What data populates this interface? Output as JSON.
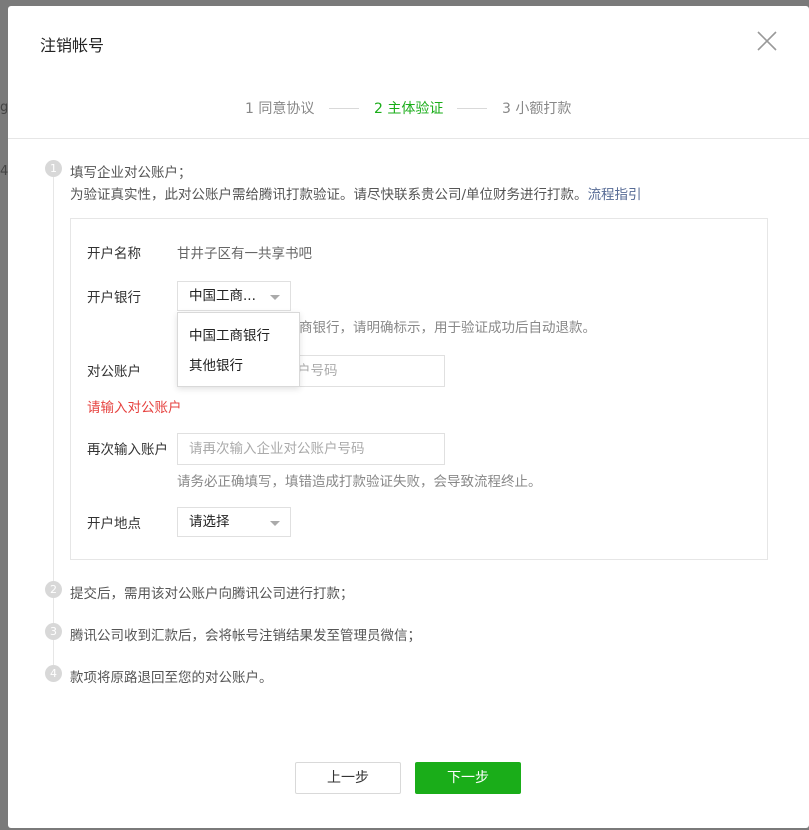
{
  "background_hints": [
    "g",
    "4"
  ],
  "dialog": {
    "title": "注销帐号",
    "close_icon": "close-icon"
  },
  "steps": [
    {
      "label": "1 同意协议",
      "active": false
    },
    {
      "label": "2 主体验证",
      "active": true
    },
    {
      "label": "3 小额打款",
      "active": false
    }
  ],
  "sections": [
    {
      "number": "1",
      "line1": "填写企业对公账户；",
      "line2": "为验证真实性，此对公账户需给腾讯打款验证。请尽快联系贵公司/单位财务进行打款。",
      "link": "流程指引"
    },
    {
      "number": "2",
      "text": "提交后，需用该对公账户向腾讯公司进行打款；"
    },
    {
      "number": "3",
      "text": "腾讯公司收到汇款后，会将帐号注销结果发至管理员微信；"
    },
    {
      "number": "4",
      "text": "款项将原路退回至您的对公账户。"
    }
  ],
  "form": {
    "account_name_label": "开户名称",
    "account_name_value": "甘井子区有一共享书吧",
    "bank_label": "开户银行",
    "bank_selected": "中国工商...",
    "bank_hint": "商银行，请明确标示，用于验证成功后自动退款。",
    "bank_options": [
      "中国工商银行",
      "其他银行"
    ],
    "account_label": "对公账户",
    "account_placeholder": "请输入企业对公账户号码",
    "account_error": "请输入对公账户",
    "reenter_label": "再次输入账户",
    "reenter_placeholder": "请再次输入企业对公账户号码",
    "reenter_hint": "请务必正确填写，填错造成打款验证失败，会导致流程终止。",
    "location_label": "开户地点",
    "location_selected": "请选择"
  },
  "buttons": {
    "prev": "上一步",
    "next": "下一步"
  },
  "colors": {
    "accent": "#1aad19",
    "error": "#e64340",
    "link": "#576b95"
  }
}
